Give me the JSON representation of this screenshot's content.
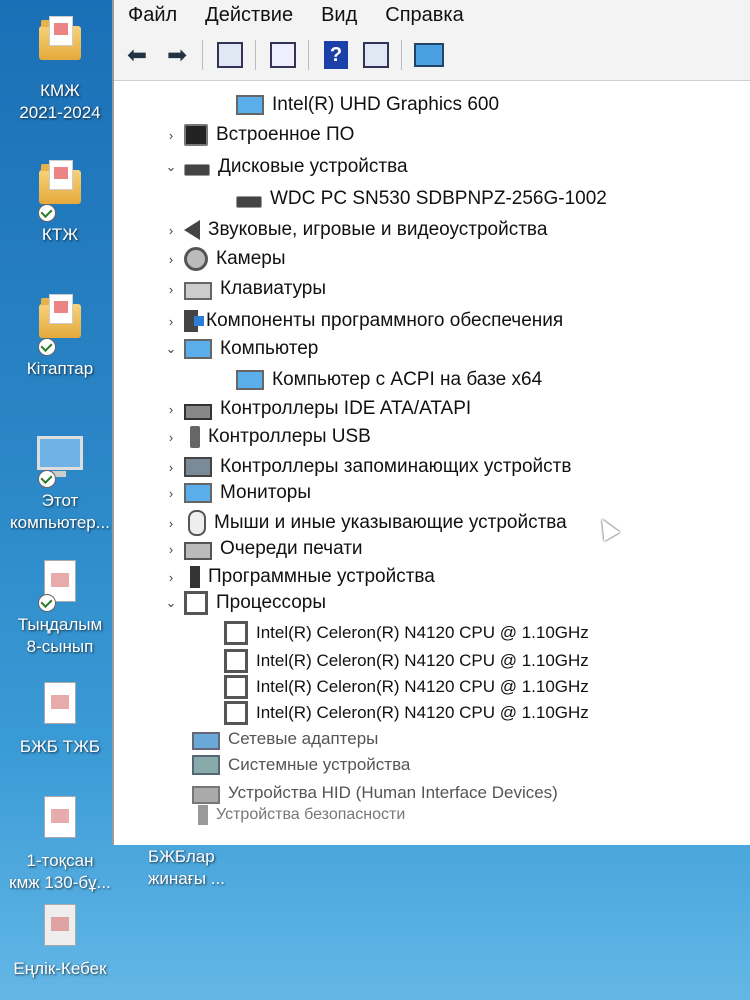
{
  "desktop": {
    "icons": [
      {
        "label1": "КМЖ",
        "label2": "2021-2024"
      },
      {
        "label1": "КТЖ",
        "label2": ""
      },
      {
        "label1": "Кітаптар",
        "label2": ""
      },
      {
        "label1": "Этот",
        "label2": "компьютер..."
      },
      {
        "label1": "Тыңдалым",
        "label2": "8-сынып"
      },
      {
        "label1": "БЖБ ТЖБ",
        "label2": ""
      },
      {
        "label1": "1-тоқсан",
        "label2": "кмж 130-бұ..."
      },
      {
        "label1": "Еңлік-Кебек",
        "label2": ""
      }
    ],
    "extra_label1": "БЖБлар",
    "extra_label2": "жинағы ..."
  },
  "window": {
    "menu": [
      "Файл",
      "Действие",
      "Вид",
      "Справка"
    ],
    "tree": [
      {
        "text": "Intel(R) UHD Graphics 600",
        "chev": "",
        "icon": "monitor-icon"
      },
      {
        "text": "Встроенное ПО",
        "chev": "›",
        "icon": "firmware-icon"
      },
      {
        "text": "Дисковые устройства",
        "chev": "⌄",
        "icon": "disk-icon"
      },
      {
        "text": "WDC PC SN530 SDBPNPZ-256G-1002",
        "chev": "",
        "icon": "disk-icon"
      },
      {
        "text": "Звуковые, игровые и видеоустройства",
        "chev": "›",
        "icon": "speaker-icon"
      },
      {
        "text": "Камеры",
        "chev": "›",
        "icon": "camera-icon"
      },
      {
        "text": "Клавиатуры",
        "chev": "›",
        "icon": "keyboard-icon"
      },
      {
        "text": "Компоненты программного обеспечения",
        "chev": "›",
        "icon": "software-component-icon"
      },
      {
        "text": "Компьютер",
        "chev": "⌄",
        "icon": "computer-icon"
      },
      {
        "text": "Компьютер с ACPI на базе x64",
        "chev": "",
        "icon": "computer-icon"
      },
      {
        "text": "Контроллеры IDE ATA/ATAPI",
        "chev": "›",
        "icon": "ide-controller-icon"
      },
      {
        "text": "Контроллеры USB",
        "chev": "›",
        "icon": "usb-icon"
      },
      {
        "text": "Контроллеры запоминающих устройств",
        "chev": "›",
        "icon": "storage-controller-icon"
      },
      {
        "text": "Мониторы",
        "chev": "›",
        "icon": "monitor-icon"
      },
      {
        "text": "Мыши и иные указывающие устройства",
        "chev": "›",
        "icon": "mouse-icon"
      },
      {
        "text": "Очереди печати",
        "chev": "›",
        "icon": "printer-icon"
      },
      {
        "text": "Программные устройства",
        "chev": "›",
        "icon": "software-device-icon"
      },
      {
        "text": "Процессоры",
        "chev": "⌄",
        "icon": "processor-icon"
      },
      {
        "text": "Intel(R) Celeron(R) N4120 CPU @ 1.10GHz",
        "chev": "",
        "icon": "processor-icon"
      },
      {
        "text": "Intel(R) Celeron(R) N4120 CPU @ 1.10GHz",
        "chev": "",
        "icon": "processor-icon"
      },
      {
        "text": "Intel(R) Celeron(R) N4120 CPU @ 1.10GHz",
        "chev": "",
        "icon": "processor-icon"
      },
      {
        "text": "Intel(R) Celeron(R) N4120 CPU @ 1.10GHz",
        "chev": "",
        "icon": "processor-icon"
      },
      {
        "text": "Сетевые адаптеры",
        "chev": "",
        "icon": "network-adapter-icon"
      },
      {
        "text": "Системные устройства",
        "chev": "",
        "icon": "system-device-icon"
      },
      {
        "text": "Устройства HID (Human Interface Devices)",
        "chev": "",
        "icon": "hid-icon"
      },
      {
        "text": "Устройства безопасности",
        "chev": "",
        "icon": "security-device-icon"
      }
    ]
  }
}
